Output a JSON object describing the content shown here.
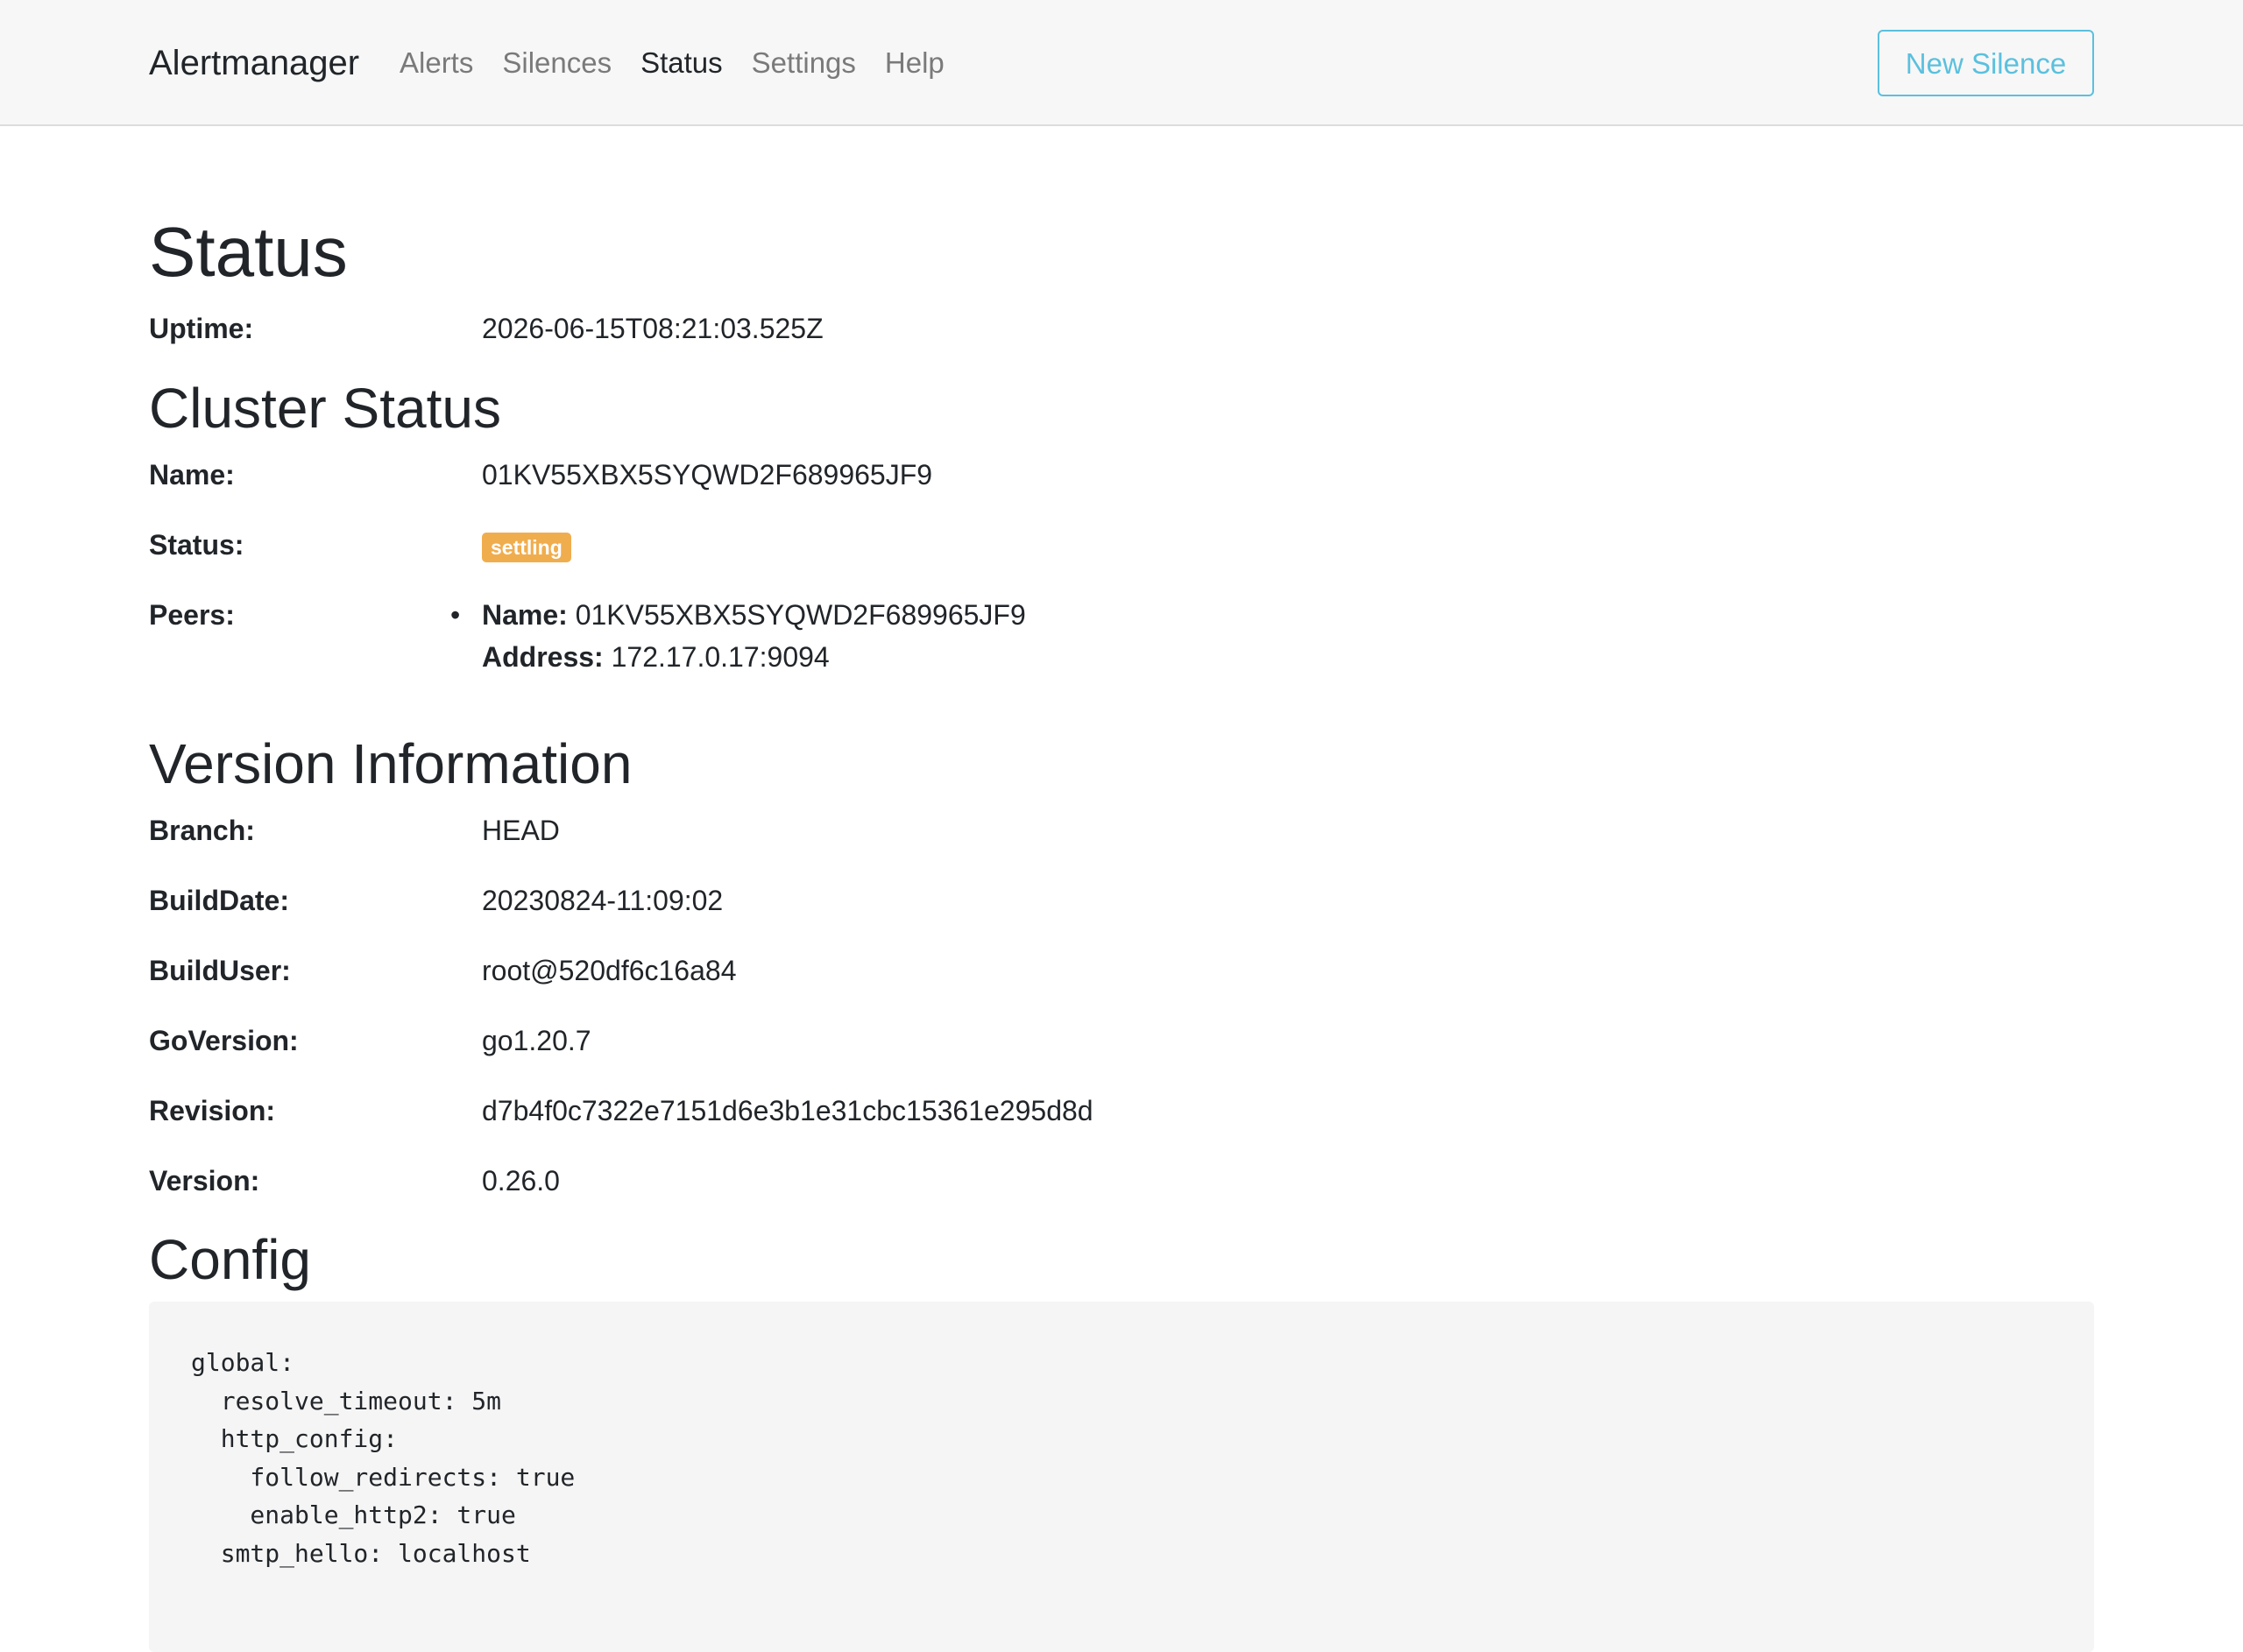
{
  "navbar": {
    "brand": "Alertmanager",
    "links": [
      {
        "label": "Alerts",
        "active": false
      },
      {
        "label": "Silences",
        "active": false
      },
      {
        "label": "Status",
        "active": true
      },
      {
        "label": "Settings",
        "active": false
      },
      {
        "label": "Help",
        "active": false
      }
    ],
    "new_silence_label": "New Silence"
  },
  "status": {
    "title": "Status",
    "uptime_label": "Uptime:",
    "uptime_value": "2026-06-15T08:21:03.525Z"
  },
  "cluster": {
    "title": "Cluster Status",
    "name_label": "Name:",
    "name_value": "01KV55XBX5SYQWD2F689965JF9",
    "status_label": "Status:",
    "status_badge": "settling",
    "peers_label": "Peers:",
    "peers": [
      {
        "name_label": "Name:",
        "name_value": "01KV55XBX5SYQWD2F689965JF9",
        "address_label": "Address:",
        "address_value": "172.17.0.17:9094"
      }
    ]
  },
  "version": {
    "title": "Version Information",
    "rows": [
      {
        "label": "Branch:",
        "value": "HEAD"
      },
      {
        "label": "BuildDate:",
        "value": "20230824-11:09:02"
      },
      {
        "label": "BuildUser:",
        "value": "root@520df6c16a84"
      },
      {
        "label": "GoVersion:",
        "value": "go1.20.7"
      },
      {
        "label": "Revision:",
        "value": "d7b4f0c7322e7151d6e3b1e31cbc15361e295d8d"
      },
      {
        "label": "Version:",
        "value": "0.26.0"
      }
    ]
  },
  "config": {
    "title": "Config",
    "text": "global:\n  resolve_timeout: 5m\n  http_config:\n    follow_redirects: true\n    enable_http2: true\n  smtp_hello: localhost"
  },
  "colors": {
    "accent": "#5bc0de",
    "badge_warning": "#f0ad4e",
    "navbar_bg": "#f7f7f7"
  }
}
